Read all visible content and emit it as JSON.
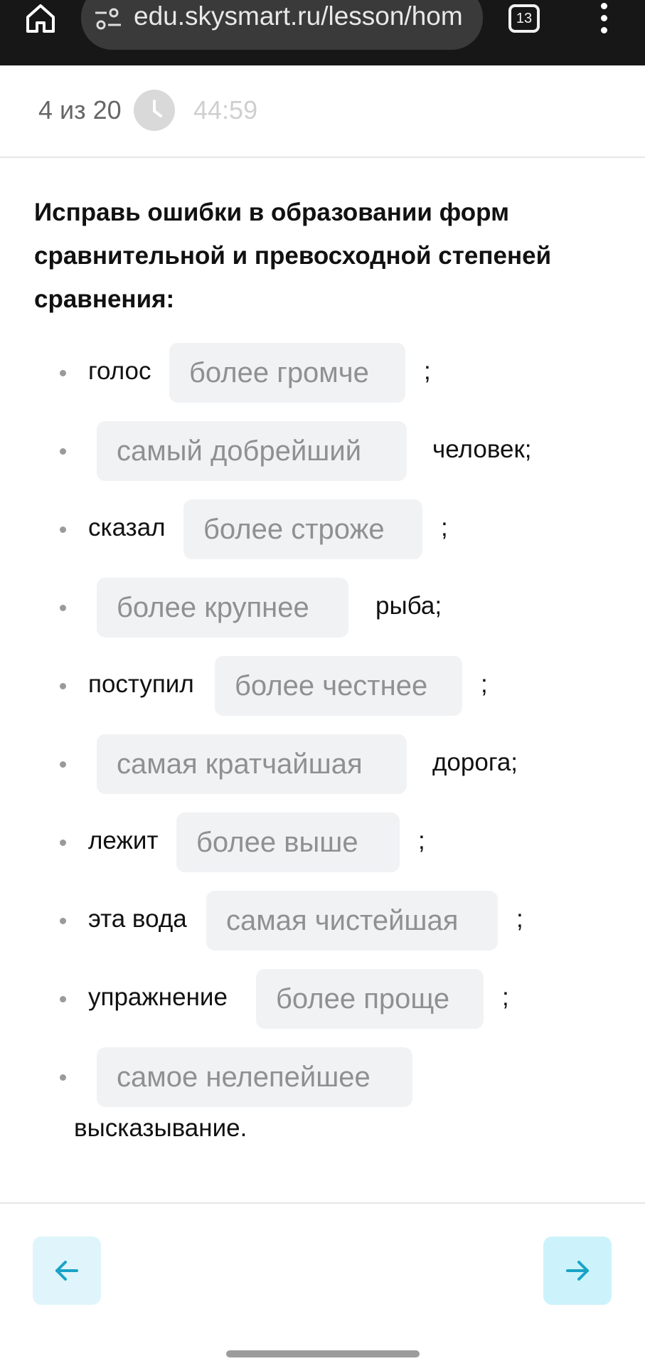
{
  "browser": {
    "url": "edu.skysmart.ru/lesson/hom",
    "tab_count": "13",
    "icons": [
      "home-icon",
      "site-settings-icon",
      "tabs-icon",
      "more-vert-icon"
    ]
  },
  "progress": {
    "counter": "4 из 20",
    "timer": "44:59",
    "icon": "clock-icon"
  },
  "question": {
    "title": "Исправь ошибки в образовании форм сравнительной и превосходной степеней сравнения:"
  },
  "items": [
    {
      "before": "голос",
      "answer": "более громче",
      "after": ";"
    },
    {
      "before": "",
      "answer": "самый добрейший",
      "after": "человек;"
    },
    {
      "before": "сказал",
      "answer": "более строже",
      "after": ";"
    },
    {
      "before": "",
      "answer": "более крупнее",
      "after": "рыба;"
    },
    {
      "before": "поступил",
      "answer": "более честнее",
      "after": ";"
    },
    {
      "before": "",
      "answer": "самая кратчайшая",
      "after": "дорога;"
    },
    {
      "before": "лежит",
      "answer": "более выше",
      "after": ";"
    },
    {
      "before": "эта вода",
      "answer": "самая чистейшая",
      "after": ";"
    },
    {
      "before": "упражнение",
      "answer": "более проще",
      "after": ";"
    },
    {
      "before": "",
      "answer": "самое нелепейшее",
      "after": "высказывание."
    }
  ],
  "nav": {
    "prev_icon": "arrow-left-icon",
    "next_icon": "arrow-right-icon"
  },
  "colors": {
    "accent": "#1aa3c8",
    "nav_bg": "#dff5fb",
    "answer_bg": "#f1f2f4"
  }
}
